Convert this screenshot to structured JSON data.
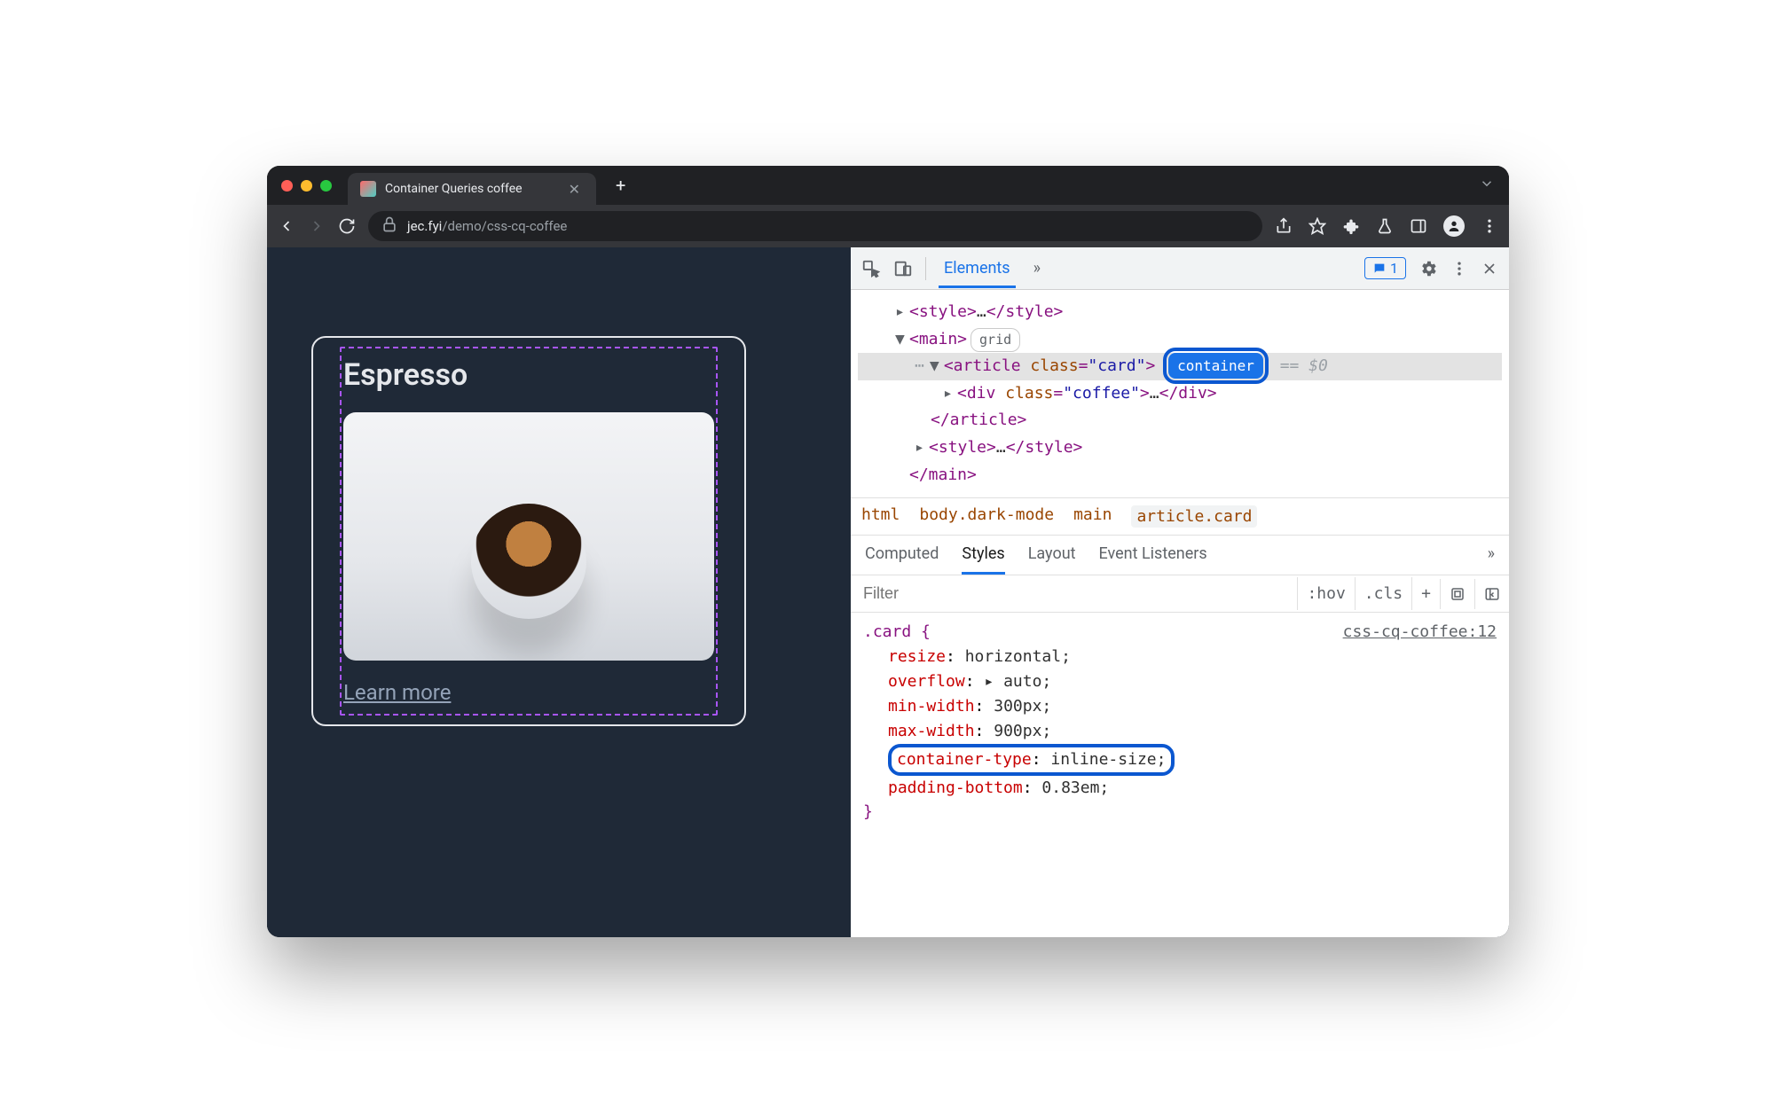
{
  "tab": {
    "title": "Container Queries coffee"
  },
  "url": {
    "domain": "jec.fyi",
    "path": "/demo/css-cq-coffee"
  },
  "page": {
    "card_title": "Espresso",
    "learn_more": "Learn more"
  },
  "devtools": {
    "panels": {
      "elements": "Elements",
      "more": "»"
    },
    "issues_count": "1",
    "dom": {
      "style_open": "<style>",
      "style_ell": "…",
      "style_close": "</style>",
      "main_open": "<main>",
      "main_badge": "grid",
      "article_open_1": "<article ",
      "article_attr": "class",
      "article_val": "\"card\"",
      "article_open_2": ">",
      "container_badge": "container",
      "eq0": "== $0",
      "div_open_1": "<div ",
      "div_attr": "class",
      "div_val": "\"coffee\"",
      "div_open_2": ">",
      "div_ell": "…",
      "div_close": "</div>",
      "article_close": "</article>",
      "style2_open": "<style>",
      "style2_ell": "…",
      "style2_close": "</style>",
      "main_close": "</main>"
    },
    "crumbs": [
      "html",
      "body.dark-mode",
      "main",
      "article.card"
    ],
    "styles_tabs": {
      "computed": "Computed",
      "styles": "Styles",
      "layout": "Layout",
      "listeners": "Event Listeners",
      "more": "»"
    },
    "filter": {
      "placeholder": "Filter",
      "hov": ":hov",
      "cls": ".cls",
      "plus": "+"
    },
    "rule": {
      "src": "css-cq-coffee:12",
      "selector": ".card {",
      "props": [
        {
          "p": "resize",
          "v": "horizontal;"
        },
        {
          "p": "overflow",
          "v": "▸ auto;"
        },
        {
          "p": "min-width",
          "v": "300px;"
        },
        {
          "p": "max-width",
          "v": "900px;"
        },
        {
          "p": "container-type",
          "v": "inline-size;",
          "highlight": true
        },
        {
          "p": "padding-bottom",
          "v": "0.83em;"
        }
      ],
      "close": "}"
    }
  }
}
